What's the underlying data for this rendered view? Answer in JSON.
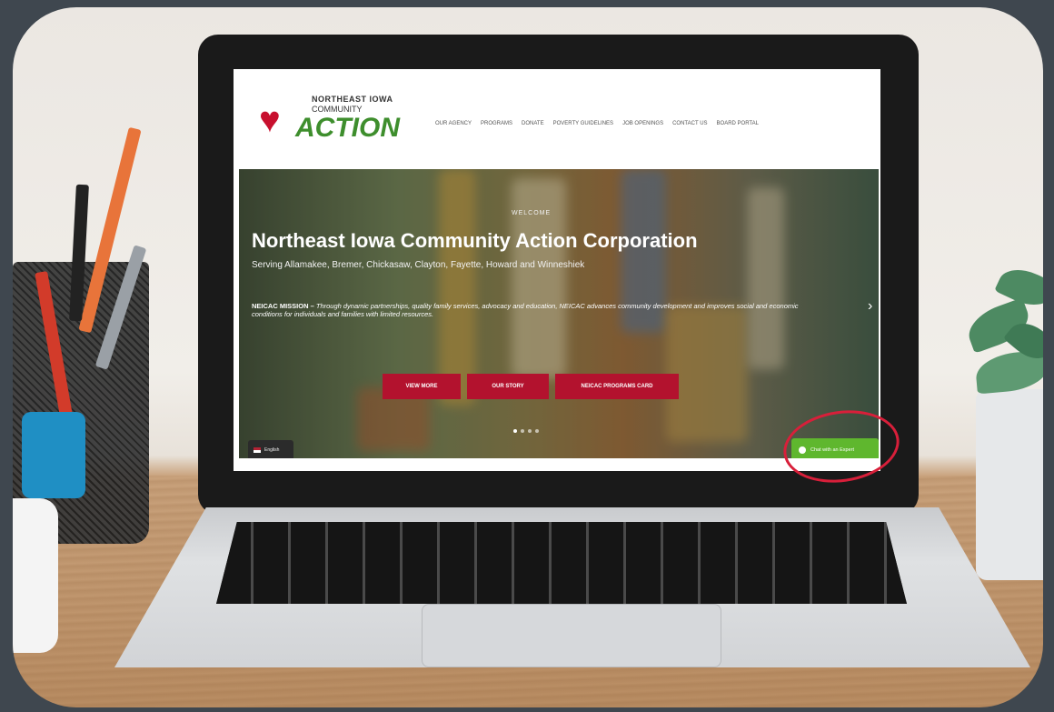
{
  "logo": {
    "line1": "NORTHEAST IOWA",
    "line2": "COMMUNITY",
    "line3": "ACTION"
  },
  "nav": {
    "items": [
      "OUR AGENCY",
      "PROGRAMS",
      "DONATE",
      "POVERTY GUIDELINES",
      "JOB OPENINGS",
      "CONTACT US",
      "BOARD PORTAL"
    ]
  },
  "hero": {
    "welcome": "WELCOME",
    "title": "Northeast Iowa Community Action Corporation",
    "subtitle": "Serving Allamakee, Bremer, Chickasaw, Clayton, Fayette, Howard and Winneshiek",
    "mission_label": "NEICAC MISSION –",
    "mission_text": "Through dynamic partnerships, quality family services, advocacy and education, NEICAC advances community development and improves social and economic conditions for individuals and families with limited resources.",
    "buttons": [
      "VIEW MORE",
      "OUR STORY",
      "NEICAC PROGRAMS CARD"
    ],
    "next_arrow": "›"
  },
  "language": {
    "label": "English"
  },
  "chat": {
    "label": "Chat with an Expert"
  },
  "colors": {
    "brand_red": "#b3122e",
    "brand_green": "#3e8e2d",
    "chat_green": "#5fb72e",
    "highlight_circle": "#d81f3a"
  }
}
